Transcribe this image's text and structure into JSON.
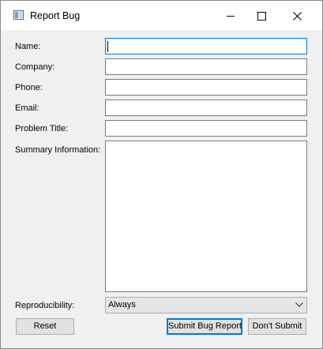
{
  "window": {
    "title": "Report Bug"
  },
  "icons": {
    "app": "app-window-icon",
    "minimize": "minimize-icon",
    "maximize": "maximize-icon",
    "close": "close-icon",
    "dropdown": "chevron-down-icon"
  },
  "form": {
    "name_label": "Name:",
    "name_value": "",
    "company_label": "Company:",
    "company_value": "",
    "phone_label": "Phone:",
    "phone_value": "",
    "email_label": "Email:",
    "email_value": "",
    "problem_title_label": "Problem Title:",
    "problem_title_value": "",
    "summary_label": "Summary Information:",
    "summary_value": "",
    "reproducibility_label": "Reproducibility:",
    "reproducibility_value": "Always"
  },
  "buttons": {
    "reset": "Reset",
    "submit": "Submit Bug Report",
    "dont_submit": "Don't Submit"
  },
  "colors": {
    "focus_accent": "#0078d7",
    "dialog_background": "#f0f0f0",
    "titlebar_background": "#ffffff"
  }
}
